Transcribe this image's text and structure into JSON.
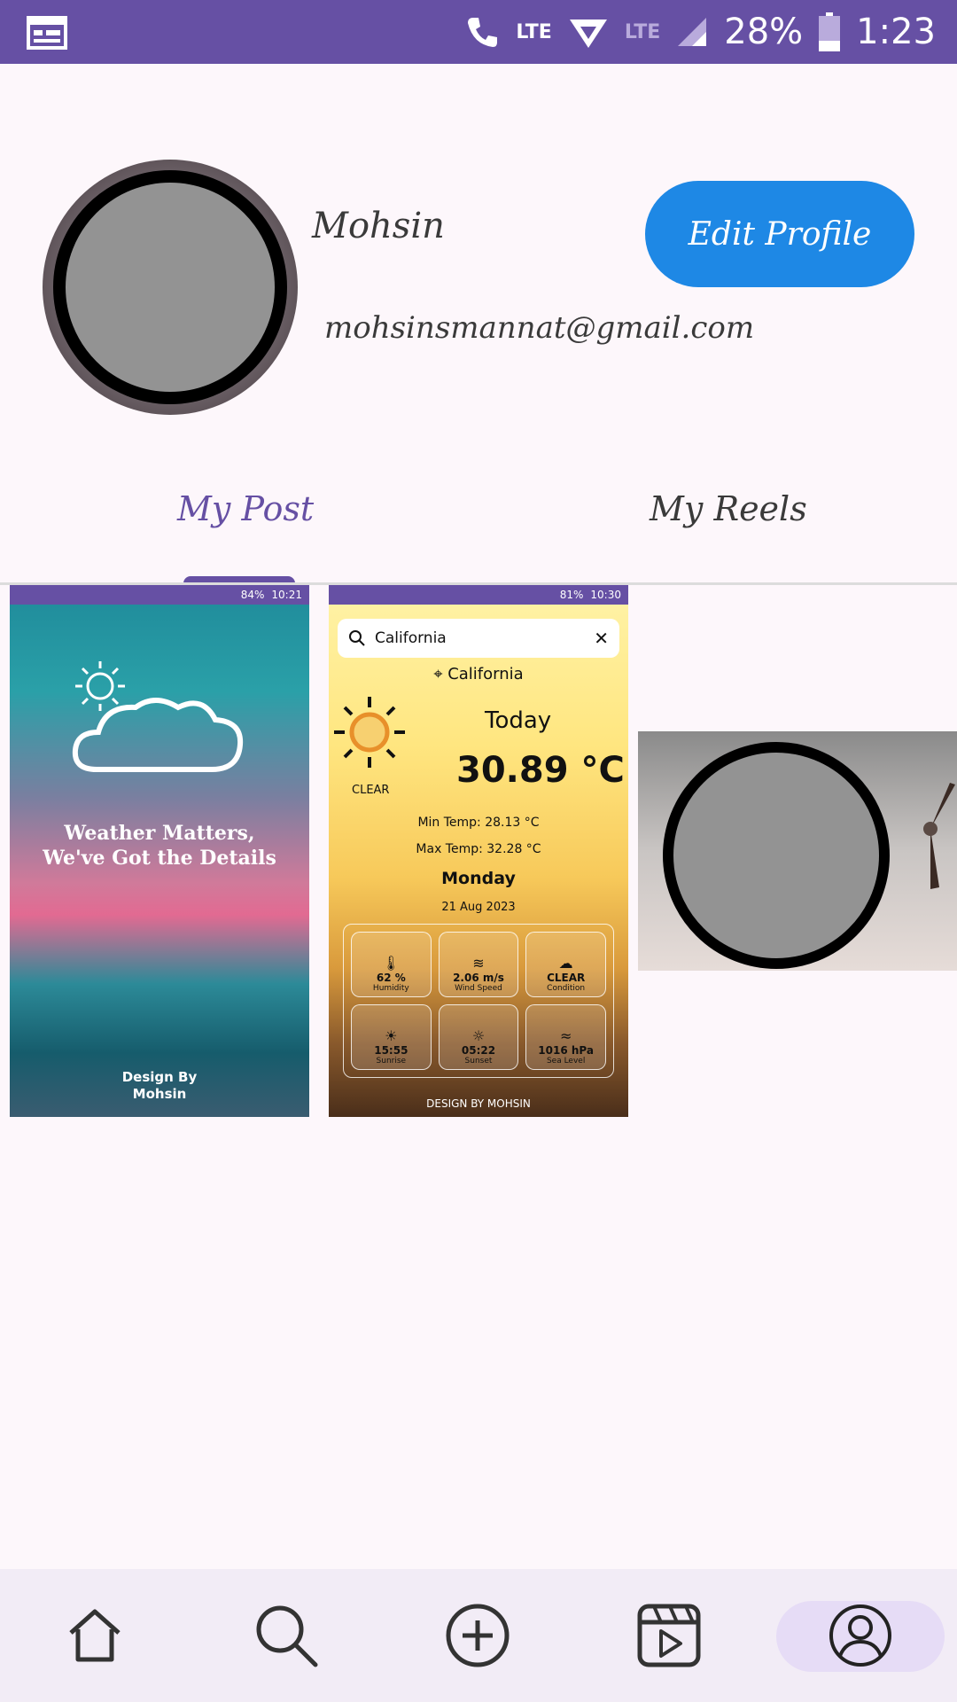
{
  "statusbar": {
    "lte_1": "LTE",
    "lte_2": "LTE",
    "battery": "28%",
    "time": "1:23",
    "color": "#6650a4"
  },
  "profile": {
    "name": "Mohsin",
    "email": "mohsinsmannat@gmail.com",
    "edit_button": "Edit Profile"
  },
  "tabs": {
    "post": "My Post",
    "reels": "My Reels",
    "active": "My Post"
  },
  "posts": {
    "post1": {
      "status_battery": "84%",
      "status_time": "10:21",
      "title_line1": "Weather Matters,",
      "title_line2": "We've Got the Details",
      "credit_line1": "Design By",
      "credit_line2": "Mohsin"
    },
    "post2": {
      "status_battery": "81%",
      "status_time": "10:30",
      "search_value": "California",
      "location": "California",
      "today": "Today",
      "temperature": "30.89 °C",
      "condition": "CLEAR",
      "min_temp": "Min Temp: 28.13 °C",
      "max_temp": "Max Temp: 32.28 °C",
      "day": "Monday",
      "date": "21 Aug 2023",
      "cells": [
        {
          "value": "62 %",
          "label": "Humidity",
          "icon": "thermometer-icon"
        },
        {
          "value": "2.06 m/s",
          "label": "Wind Speed",
          "icon": "wind-icon"
        },
        {
          "value": "CLEAR",
          "label": "Condition",
          "icon": "cloud-sun-icon"
        },
        {
          "value": "15:55",
          "label": "Sunrise",
          "icon": "sunrise-icon"
        },
        {
          "value": "05:22",
          "label": "Sunset",
          "icon": "sunset-icon"
        },
        {
          "value": "1016 hPa",
          "label": "Sea Level",
          "icon": "waves-icon"
        }
      ],
      "credit": "DESIGN BY MOHSIN"
    }
  },
  "bottom_nav": [
    {
      "icon": "home-icon"
    },
    {
      "icon": "search-icon"
    },
    {
      "icon": "add-icon"
    },
    {
      "icon": "reels-icon"
    },
    {
      "icon": "profile-icon",
      "active": true
    }
  ],
  "colors": {
    "accent": "#6650a4",
    "button": "#1e88e5",
    "background": "#fdf7fb",
    "nav_background": "#f2ecf6"
  }
}
